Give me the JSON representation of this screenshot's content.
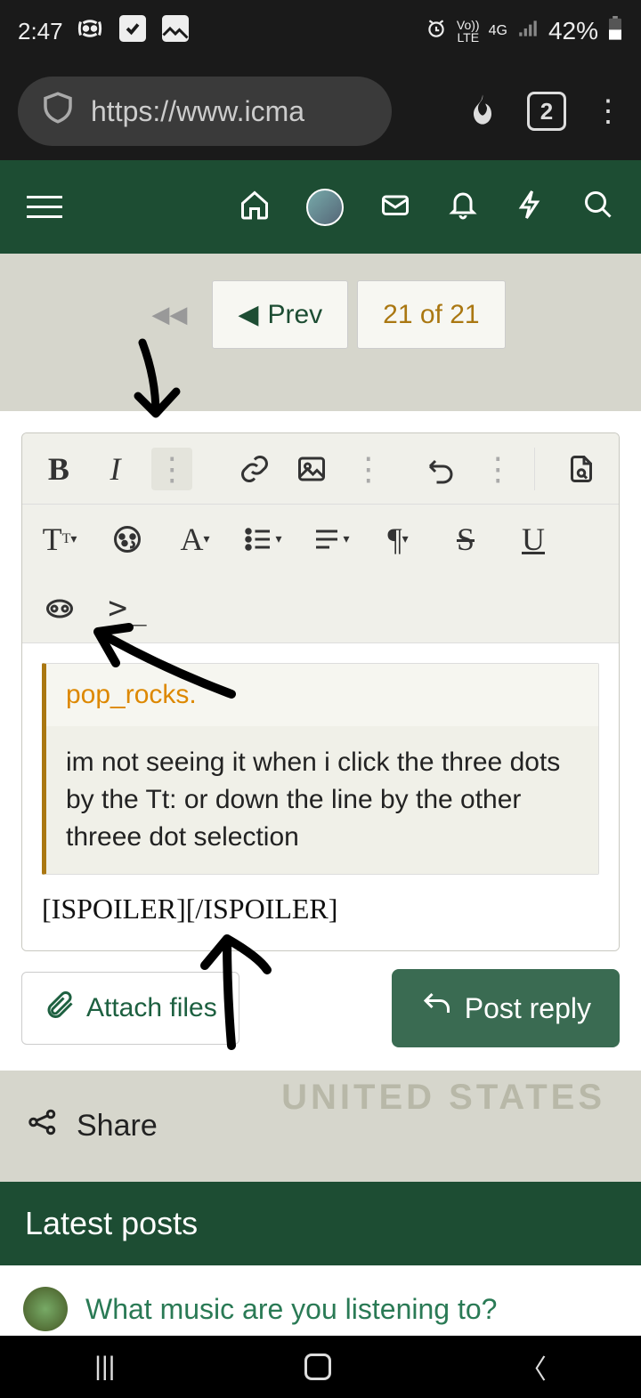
{
  "status": {
    "time": "2:47",
    "battery": "42%",
    "network1": "Vo))",
    "network2": "LTE",
    "network3": "4G"
  },
  "browser": {
    "url": "https://www.icma",
    "tab_count": "2"
  },
  "pagination": {
    "prev_label": "Prev",
    "current_label": "21 of 21"
  },
  "editor": {
    "quote_author": "pop_rocks.",
    "quote_text": "im not seeing it when i click the three dots by the Tt: or down the line by the other threee dot selection",
    "spoiler_text": "[ISPOILER][/ISPOILER]"
  },
  "actions": {
    "attach_label": "Attach files",
    "post_label": "Post reply"
  },
  "share": {
    "label": "Share",
    "watermark": "UNITED STATES"
  },
  "latest": {
    "heading": "Latest posts",
    "post1_title": "What music are you listening to?"
  }
}
